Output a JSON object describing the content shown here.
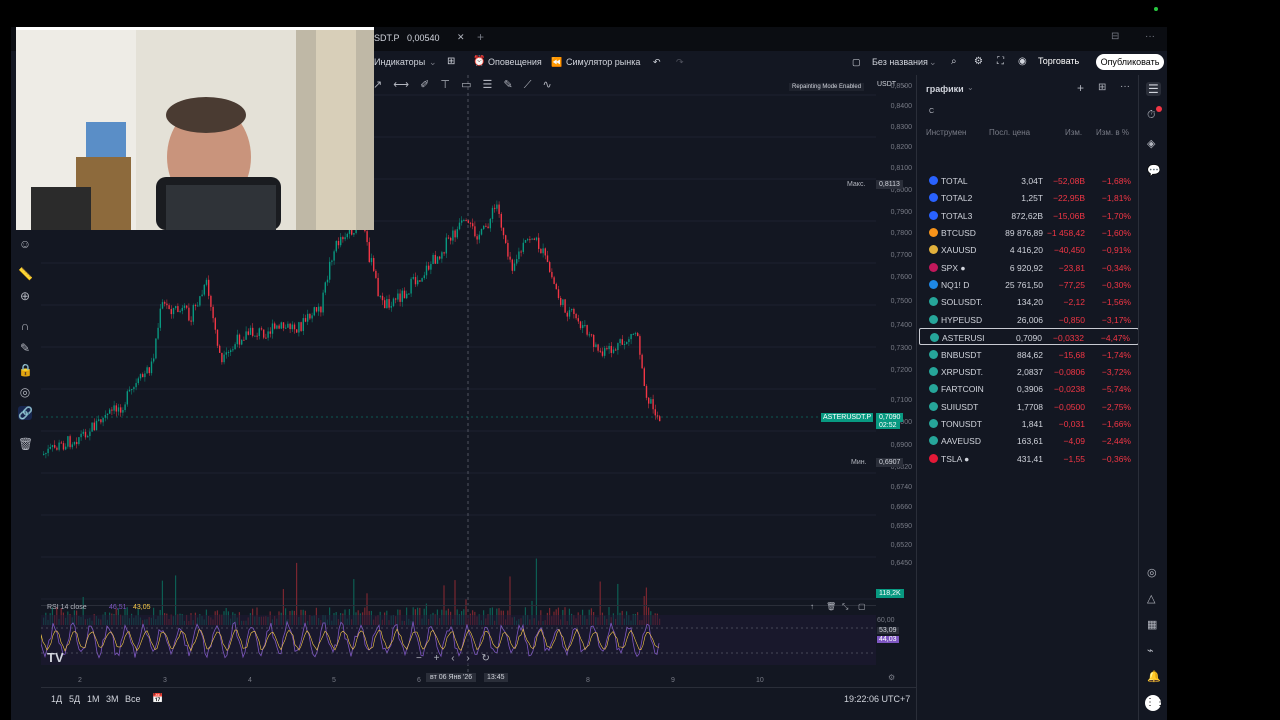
{
  "tab": {
    "title": "SDT.P",
    "price": "0,00540",
    "close": "✕",
    "add": "+"
  },
  "toolbar": {
    "indicators": "Индикаторы",
    "alerts": "Оповещения",
    "simulator": "Симулятор рынка",
    "layout_name": "Без названия",
    "trade": "Торговать",
    "publish": "Опубликовать"
  },
  "chart": {
    "currency": "USDT",
    "repainting": "Repainting Mode Enabled",
    "max_label": "Макс.",
    "max_value": "0,8113",
    "min_label": "Мин.",
    "min_value": "0,6907",
    "symbol_tag": "ASTERUSDT.P",
    "symbol_price": "0,7090",
    "symbol_time": "02:52",
    "volume_tag": "118,2K",
    "rsi_label": "RSI 14 close",
    "rsi_v1": "46,51",
    "rsi_v2": "43,05",
    "rsi_levels": [
      "60,00",
      "53,09",
      "44,03"
    ],
    "price_levels": [
      "0,8500",
      "0,8400",
      "0,8300",
      "0,8200",
      "0,8100",
      "0,8000",
      "0,7900",
      "0,7800",
      "0,7700",
      "0,7600",
      "0,7500",
      "0,7400",
      "0,7300",
      "0,7200",
      "0,7100",
      "0,7000",
      "0,6900",
      "0,6820",
      "0,6740",
      "0,6660",
      "0,6590",
      "0,6520",
      "0,6450"
    ],
    "x_ticks": [
      "2",
      "3",
      "4",
      "5",
      "6",
      "8",
      "9",
      "10"
    ],
    "crosshair_date": "вт 06 Янв '26",
    "crosshair_time": "13:45"
  },
  "bottom": {
    "timeframes": [
      "1Д",
      "5Д",
      "1М",
      "3М",
      "Все"
    ],
    "clock": "19:22:06 UTC+7"
  },
  "watchlist": {
    "title": "графики",
    "search_hint": "С",
    "headers": {
      "symbol": "Инструмен",
      "last": "Посл. цена",
      "chg": "Изм.",
      "pct": "Изм. в %"
    },
    "rows": [
      {
        "sym": "TOTAL",
        "last": "3,04T",
        "chg": "−52,08B",
        "pct": "−1,68%",
        "color": "#2962ff"
      },
      {
        "sym": "TOTAL2",
        "last": "1,25T",
        "chg": "−22,95B",
        "pct": "−1,81%",
        "color": "#2962ff"
      },
      {
        "sym": "TOTAL3",
        "last": "872,62B",
        "chg": "−15,06B",
        "pct": "−1,70%",
        "color": "#2962ff"
      },
      {
        "sym": "BTCUSD",
        "last": "89 876,89",
        "chg": "−1 458,42",
        "pct": "−1,60%",
        "color": "#f7931a"
      },
      {
        "sym": "XAUUSD",
        "last": "4 416,20",
        "chg": "−40,450",
        "pct": "−0,91%",
        "color": "#e2b13c"
      },
      {
        "sym": "SPX ●",
        "last": "6 920,92",
        "chg": "−23,81",
        "pct": "−0,34%",
        "color": "#c2185b"
      },
      {
        "sym": "NQ1! D",
        "last": "25 761,50",
        "chg": "−77,25",
        "pct": "−0,30%",
        "color": "#1e88e5"
      },
      {
        "sym": "SOLUSDT.",
        "last": "134,20",
        "chg": "−2,12",
        "pct": "−1,56%",
        "color": "#26a69a"
      },
      {
        "sym": "HYPEUSD",
        "last": "26,006",
        "chg": "−0,850",
        "pct": "−3,17%",
        "color": "#26a69a"
      },
      {
        "sym": "ASTERUSI",
        "last": "0,7090",
        "chg": "−0,0332",
        "pct": "−4,47%",
        "color": "#26a69a"
      },
      {
        "sym": "BNBUSDT",
        "last": "884,62",
        "chg": "−15,68",
        "pct": "−1,74%",
        "color": "#26a69a"
      },
      {
        "sym": "XRPUSDT.",
        "last": "2,0837",
        "chg": "−0,0806",
        "pct": "−3,72%",
        "color": "#26a69a"
      },
      {
        "sym": "FARTCOIN",
        "last": "0,3906",
        "chg": "−0,0238",
        "pct": "−5,74%",
        "color": "#26a69a"
      },
      {
        "sym": "SUIUSDT",
        "last": "1,7708",
        "chg": "−0,0500",
        "pct": "−2,75%",
        "color": "#26a69a"
      },
      {
        "sym": "TONUSDT",
        "last": "1,841",
        "chg": "−0,031",
        "pct": "−1,66%",
        "color": "#26a69a"
      },
      {
        "sym": "AAVEUSD",
        "last": "163,61",
        "chg": "−4,09",
        "pct": "−2,44%",
        "color": "#26a69a"
      },
      {
        "sym": "TSLA ●",
        "last": "431,41",
        "chg": "−1,55",
        "pct": "−0,36%",
        "color": "#e31937"
      }
    ],
    "selected_index": 9
  }
}
